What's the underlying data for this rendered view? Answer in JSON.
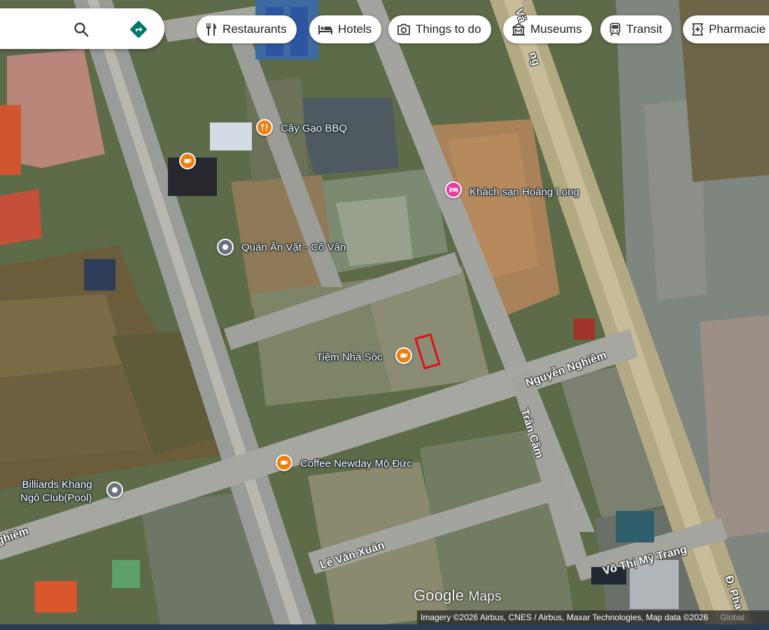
{
  "search": {
    "search_icon": "search-icon",
    "directions_icon": "directions-icon",
    "directions_color": "#00796b"
  },
  "chips": [
    {
      "label": "Restaurants",
      "icon": "fork-knife-icon"
    },
    {
      "label": "Hotels",
      "icon": "bed-icon"
    },
    {
      "label": "Things to do",
      "icon": "camera-icon"
    },
    {
      "label": "Museums",
      "icon": "museum-icon"
    },
    {
      "label": "Transit",
      "icon": "train-icon"
    },
    {
      "label": "Pharmacie",
      "icon": "pharmacy-icon"
    }
  ],
  "places": {
    "cay_gao": "Cây Gạo BBQ",
    "khach_san": "Khách sạn Hoàng Long",
    "quan_an": "Quán Ăn Vặt - Cô Vân",
    "tiem_nha_soc": "Tiệm Nhà Sóc",
    "coffee_newday": "Coffee Newday Mộ Đức",
    "billiards_line1": "Billiards Khang",
    "billiards_line2": "Ngô Club(Pool)"
  },
  "streets": {
    "nguyen_nghiem": "Nguyễn Nghiêm",
    "nghiem_left": "ghiêm",
    "tran_cam": "Trần Cầm",
    "le_van_xuan": "Lê Văn Xuân",
    "vo_thi_my_trang": "Võ Thị Mỹ Trang",
    "d_pha": "Đ. Pha",
    "van_top": "Vă",
    "ng_top": "ng"
  },
  "logo": {
    "google": "Google",
    "maps": "Maps"
  },
  "attribution": {
    "text": "Imagery ©2026 Airbus, CNES / Airbus, Maxar Technologies, Map data ©2026",
    "global": "Global"
  },
  "colors": {
    "food_pin": "#f07d0e",
    "hotel_pin": "#e53e9c",
    "generic_pin": "#6b7280",
    "selection": "#e0101a"
  }
}
